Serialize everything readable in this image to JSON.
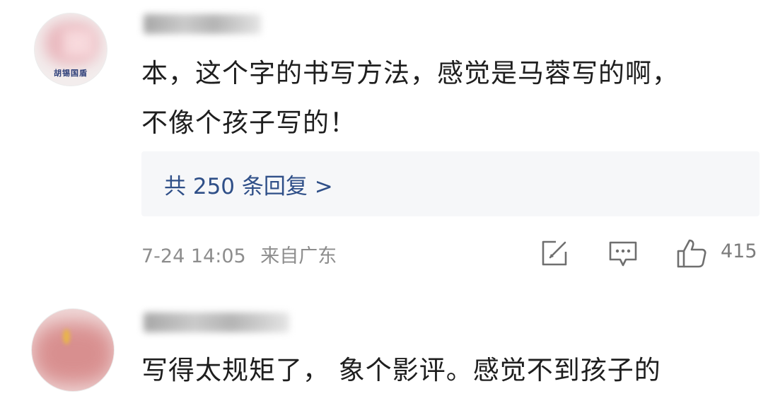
{
  "comments": [
    {
      "avatar_caption": "胡锡国盾",
      "text_line1": "本，这个字的书写方法，感觉是马蓉写的啊，",
      "text_line2": "不像个孩子写的！",
      "replies_label": "共 250 条回复 >",
      "date": "7-24 14:05",
      "location": "来自广东",
      "likes": "415"
    },
    {
      "text_line1": "写得太规矩了，  象个影评。感觉不到孩子的"
    }
  ],
  "icons": {
    "share": "edit-share-icon",
    "comment": "comment-icon",
    "like": "thumbs-up-icon"
  },
  "colors": {
    "link": "#2f4f88",
    "meta": "#8d8d8d",
    "reply_bg": "#f6f7f9"
  }
}
